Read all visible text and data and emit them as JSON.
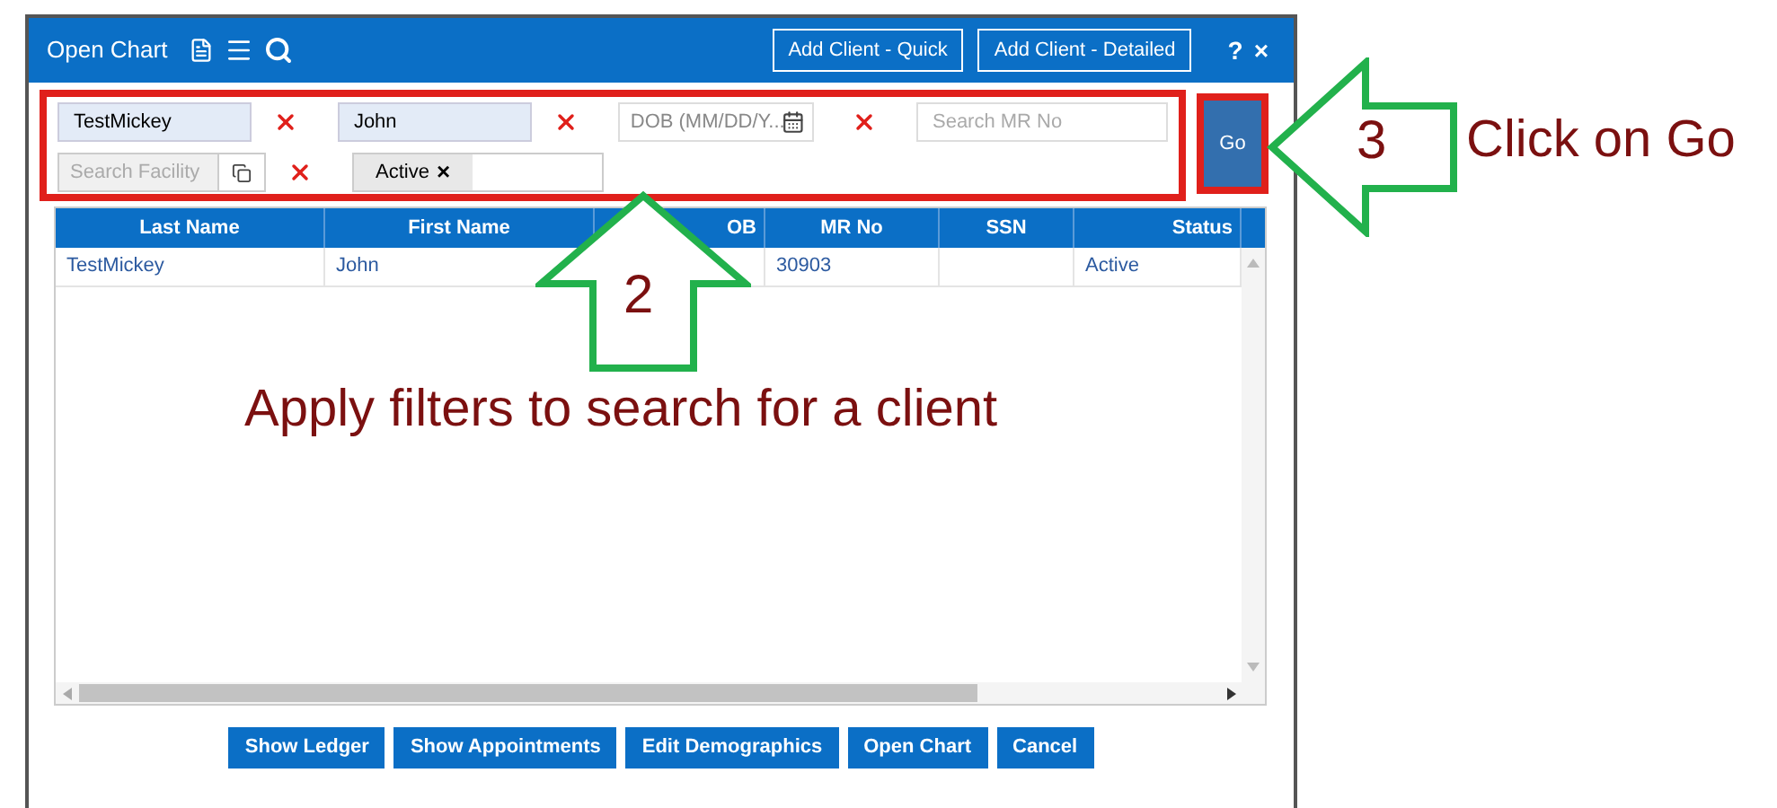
{
  "window": {
    "title": "Open Chart",
    "header_buttons": [
      "Add Client - Quick",
      "Add Client - Detailed"
    ],
    "help": "?",
    "close": "×"
  },
  "filters": {
    "last_name": {
      "value": "TestMickey"
    },
    "first_name": {
      "value": "John"
    },
    "dob": {
      "placeholder": "DOB (MM/DD/Y..."
    },
    "mr_no": {
      "placeholder": "Search MR No"
    },
    "facility": {
      "placeholder": "Search Facility"
    },
    "status_tag": {
      "label": "Active",
      "remove": "×"
    }
  },
  "go_button": "Go",
  "table": {
    "columns": [
      "Last Name",
      "First Name",
      "OB",
      "MR No",
      "SSN",
      "Status"
    ],
    "rows": [
      {
        "cells": [
          "TestMickey",
          "John",
          null,
          "30903",
          null,
          "Active"
        ]
      }
    ]
  },
  "buttons": [
    "Show Ledger",
    "Show Appointments",
    "Edit Demographics",
    "Open Chart",
    "Cancel"
  ],
  "annotations": [
    {
      "number": "2",
      "caption": "Apply filters to search for a client"
    },
    {
      "number": "3",
      "caption": "Click on Go"
    }
  ]
}
